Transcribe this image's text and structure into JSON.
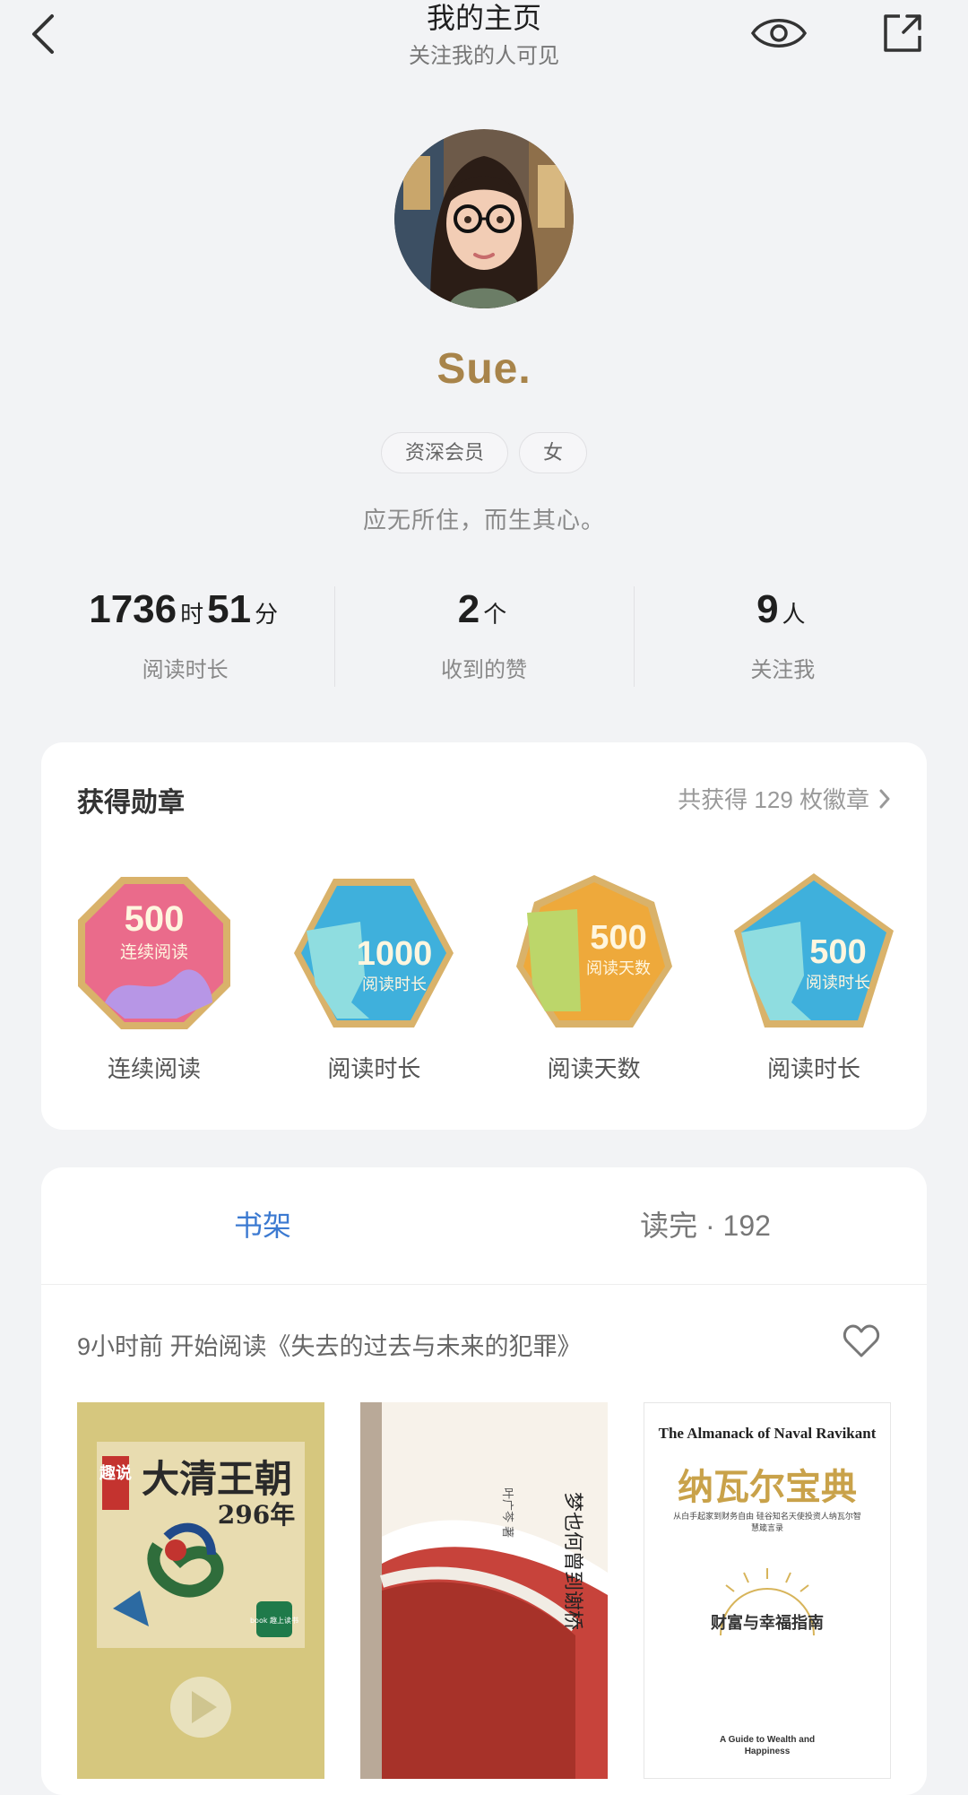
{
  "header": {
    "title": "我的主页",
    "subtitle": "关注我的人可见"
  },
  "profile": {
    "name": "Sue.",
    "tags": [
      "资深会员",
      "女"
    ],
    "bio": "应无所住，而生其心。"
  },
  "stats": [
    {
      "parts": [
        "1736",
        "时",
        "51",
        "分"
      ],
      "label": "阅读时长"
    },
    {
      "parts": [
        "2",
        "个"
      ],
      "label": "收到的赞"
    },
    {
      "parts": [
        "9",
        "人"
      ],
      "label": "关注我"
    }
  ],
  "medals": {
    "title": "获得勋章",
    "summary": "共获得 129 枚徽章",
    "items": [
      {
        "number": "500",
        "caption": "连续阅读",
        "label": "连续阅读",
        "color": "#ea6b8b"
      },
      {
        "number": "1000",
        "caption": "阅读时长",
        "label": "阅读时长",
        "color": "#3fb0dc"
      },
      {
        "number": "500",
        "caption": "阅读天数",
        "label": "阅读天数",
        "color": "#eea93b"
      },
      {
        "number": "500",
        "caption": "阅读时长",
        "label": "阅读时长",
        "color": "#3fb0dc"
      }
    ]
  },
  "shelf": {
    "tabs": [
      "书架",
      "读完 · 192"
    ],
    "activity": "9小时前 开始阅读《失去的过去与未来的犯罪》",
    "books": [
      {
        "cover_title": "大清王朝",
        "cover_subtitle": "296年",
        "cover_badge": "趣说",
        "cover_brand": "book 趣上读书"
      },
      {
        "cover_title": "梦也何曾到谢桥",
        "cover_author": "叶广芩 著"
      },
      {
        "cover_title_en": "The Almanack of Naval Ravikant",
        "cover_title": "纳瓦尔宝典",
        "cover_tagline": "从白手起家到财务自由 硅谷知名天使投资人纳瓦尔智慧箴言录",
        "cover_subtitle": "财富与幸福指南",
        "cover_sub_en": "A Guide to Wealth and Happiness"
      }
    ]
  },
  "colors": {
    "accent": "#3c7ad1",
    "name_gold": "#a8844a",
    "background": "#f2f3f5"
  }
}
